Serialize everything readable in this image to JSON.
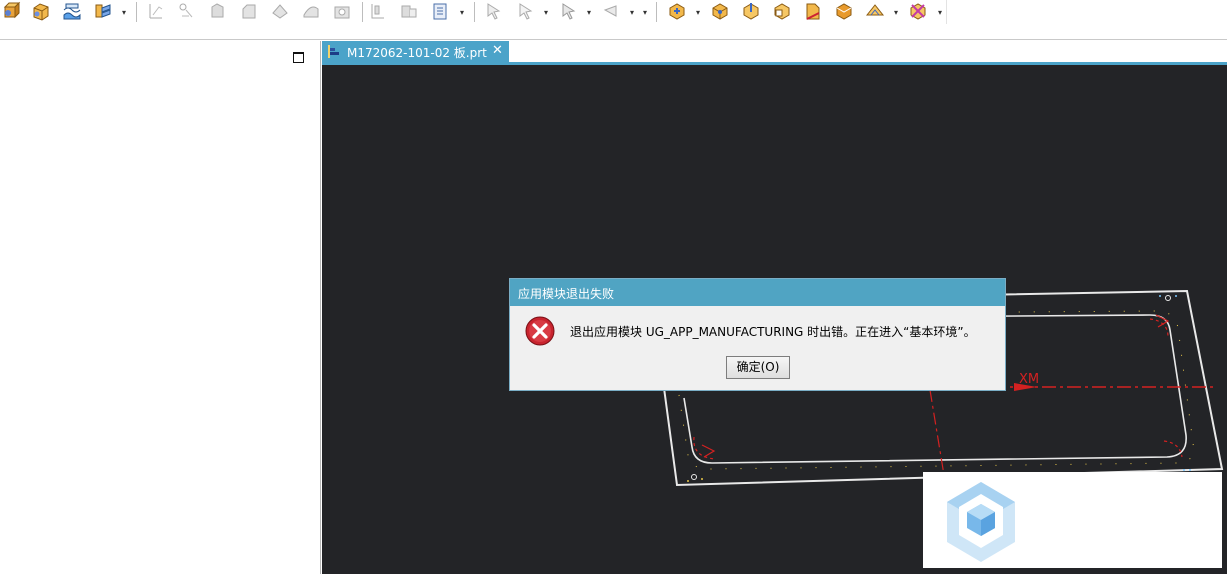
{
  "toolbar": {
    "buttons": [
      "feature-icon",
      "block-icon",
      "sheet-icon",
      "sync-icon",
      "curve-icon",
      "trim-icon",
      "extrude-icon",
      "chamfer-icon",
      "offset-icon",
      "blend-icon",
      "hole-icon",
      "pattern-icon",
      "split-icon",
      "info-icon",
      "select-filter-icon",
      "select-icon",
      "move-icon",
      "snap-icon",
      "view-fit-icon",
      "view-iso-icon",
      "view-top-icon",
      "view-front-icon",
      "view-section-icon",
      "view-shade-icon",
      "view-wire-icon",
      "view-hide-icon"
    ]
  },
  "graphics": {
    "tab_label": "M172062-101-02  板.prt",
    "close_glyph": "✕",
    "axis_label": "XM",
    "background": "#232427",
    "accent": "#4ba3c9"
  },
  "dialog": {
    "title": "应用模块退出失败",
    "message": "退出应用模块 UG_APP_MANUFACTURING 时出错。正在进入“基本环境”。",
    "ok_label": "确定(O)",
    "icon": "error-icon"
  },
  "watermark": {
    "icon": "cube-logo-icon"
  }
}
